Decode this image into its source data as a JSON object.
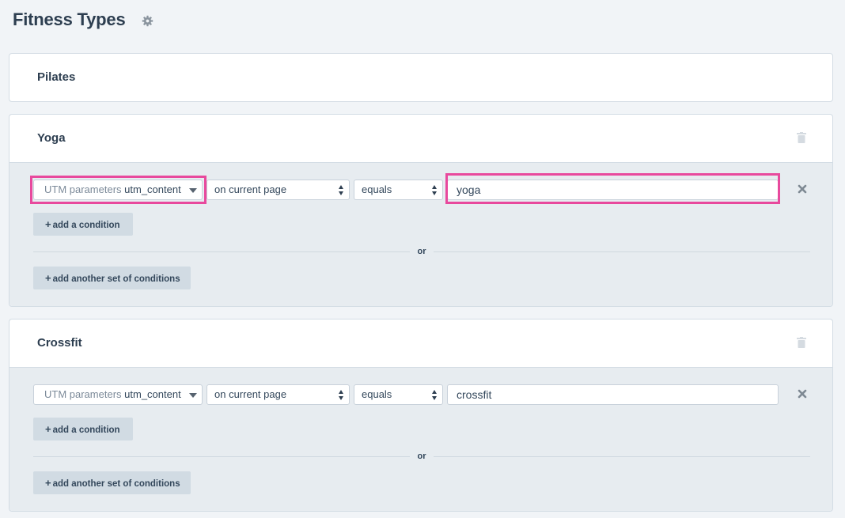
{
  "page": {
    "title": "Fitness Types"
  },
  "cards": [
    {
      "title": "Pilates"
    },
    {
      "title": "Yoga",
      "condition": {
        "param_prefix": "UTM parameters",
        "param_value": "utm_content",
        "scope": "on current page",
        "operator": "equals",
        "value": "yoga"
      },
      "add_condition_label": "add a condition",
      "or_label": "or",
      "add_set_label": "add another set of conditions"
    },
    {
      "title": "Crossfit",
      "condition": {
        "param_prefix": "UTM parameters",
        "param_value": "utm_content",
        "scope": "on current page",
        "operator": "equals",
        "value": "crossfit"
      },
      "add_condition_label": "add a condition",
      "or_label": "or",
      "add_set_label": "add another set of conditions"
    }
  ],
  "icons": {
    "settings": "gear-icon",
    "delete": "trash-icon",
    "remove_condition": "close-icon",
    "add": "plus-icon"
  },
  "colors": {
    "highlight": "#e8499d",
    "background": "#f1f4f7",
    "panel": "#e7ecf0",
    "button": "#d1dbe3",
    "text": "#2d3e50"
  }
}
